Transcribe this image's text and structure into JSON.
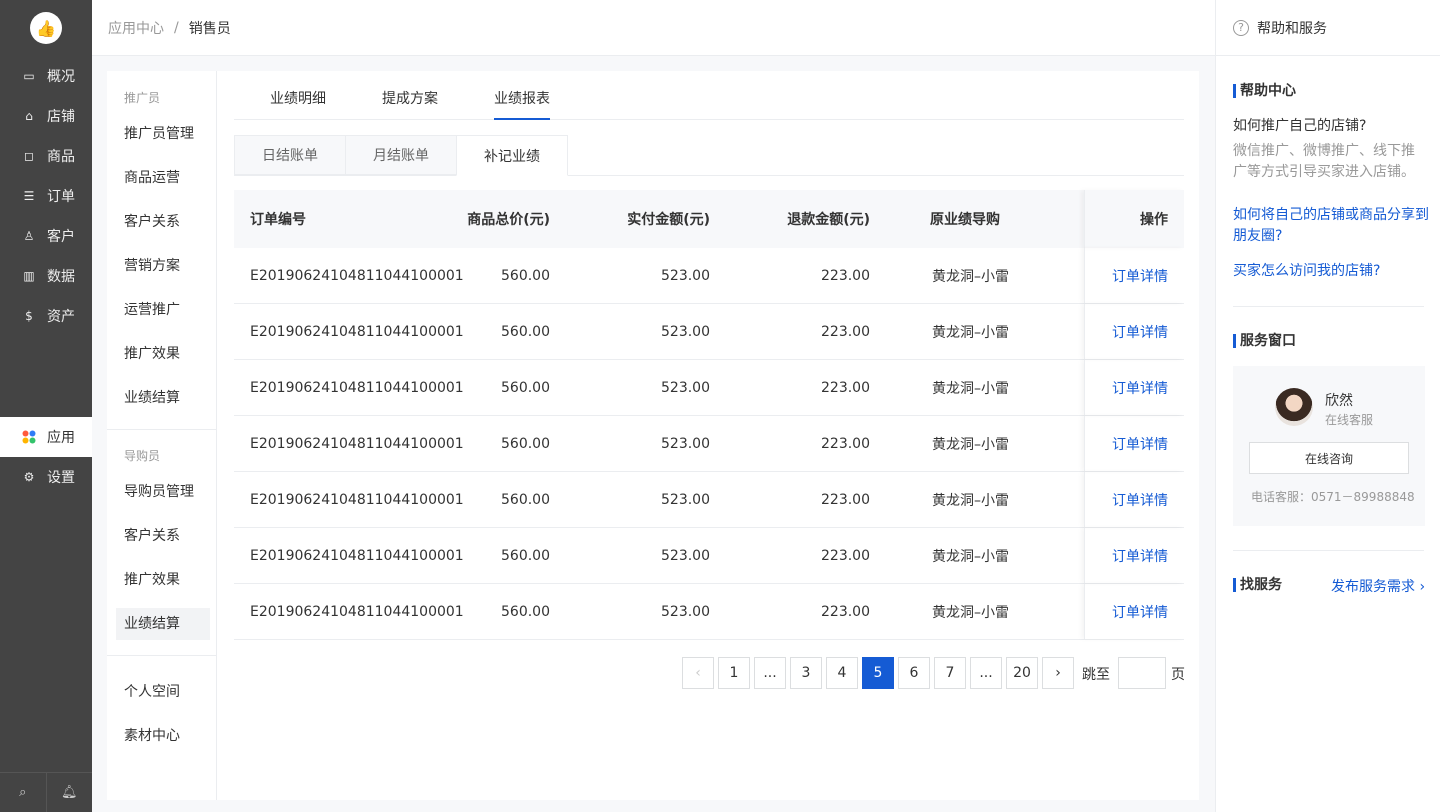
{
  "sidebar": {
    "logo_icon": "thumbs-up-icon",
    "items": [
      {
        "label": "概况",
        "icon": "dashboard-icon"
      },
      {
        "label": "店铺",
        "icon": "store-icon"
      },
      {
        "label": "商品",
        "icon": "bag-icon"
      },
      {
        "label": "订单",
        "icon": "order-icon"
      },
      {
        "label": "客户",
        "icon": "user-icon"
      },
      {
        "label": "数据",
        "icon": "bar-chart-icon"
      },
      {
        "label": "资产",
        "icon": "money-icon"
      },
      {
        "label": "应用",
        "icon": "apps-icon",
        "active": true
      },
      {
        "label": "设置",
        "icon": "gear-icon"
      }
    ],
    "bottom": {
      "search_icon": "search-icon",
      "bell_icon": "bell-icon"
    }
  },
  "breadcrumb": {
    "first": "应用中心",
    "separator": "/",
    "current": "销售员"
  },
  "subnav": {
    "group1_title": "推广员",
    "group1": [
      "推广员管理",
      "商品运营",
      "客户关系",
      "营销方案",
      "运营推广",
      "推广效果",
      "业绩结算"
    ],
    "group2_title": "导购员",
    "group2": [
      "导购员管理",
      "客户关系",
      "推广效果",
      "业绩结算"
    ],
    "group3": [
      "个人空间",
      "素材中心"
    ]
  },
  "tabs": [
    "业绩明细",
    "提成方案",
    "业绩报表"
  ],
  "active_tab": "业绩报表",
  "card_tabs": [
    "日结账单",
    "月结账单",
    "补记业绩"
  ],
  "active_card_tab": "补记业绩",
  "table": {
    "headers": [
      "订单编号",
      "商品总价(元)",
      "实付金额(元)",
      "退款金额(元)",
      "原业绩导购",
      "操作"
    ],
    "rows": [
      [
        "E20190624104811044100001",
        "560.00",
        "523.00",
        "223.00",
        "黄龙洞–小雷",
        "订单详情"
      ],
      [
        "E20190624104811044100001",
        "560.00",
        "523.00",
        "223.00",
        "黄龙洞–小雷",
        "订单详情"
      ],
      [
        "E20190624104811044100001",
        "560.00",
        "523.00",
        "223.00",
        "黄龙洞–小雷",
        "订单详情"
      ],
      [
        "E20190624104811044100001",
        "560.00",
        "523.00",
        "223.00",
        "黄龙洞–小雷",
        "订单详情"
      ],
      [
        "E20190624104811044100001",
        "560.00",
        "523.00",
        "223.00",
        "黄龙洞–小雷",
        "订单详情"
      ],
      [
        "E20190624104811044100001",
        "560.00",
        "523.00",
        "223.00",
        "黄龙洞–小雷",
        "订单详情"
      ],
      [
        "E20190624104811044100001",
        "560.00",
        "523.00",
        "223.00",
        "黄龙洞–小雷",
        "订单详情"
      ]
    ]
  },
  "pagination": {
    "pages": [
      "1",
      "...",
      "3",
      "4",
      "5",
      "6",
      "7",
      "...",
      "20"
    ],
    "current": "5",
    "jump_label": "跳至",
    "jump_suffix": "页",
    "jump_value": ""
  },
  "help": {
    "title": "帮助和服务",
    "center_title": "帮助中心",
    "question": "如何推广自己的店铺?",
    "answer": "微信推广、微博推广、线下推广等方式引导买家进入店铺。",
    "links": [
      "如何将自己的店铺或商品分享到朋友圈?",
      "买家怎么访问我的店铺?"
    ],
    "service_title": "服务窗口",
    "agent_name": "欣然",
    "agent_role": "在线客服",
    "consult_button": "在线咨询",
    "phone": "电话客服：0571－89988848",
    "find_title": "找服务",
    "find_link": "发布服务需求"
  },
  "colors": {
    "accent": "#155bd4",
    "sidebar_bg": "#444444",
    "page_bg": "#f7f8fa"
  }
}
